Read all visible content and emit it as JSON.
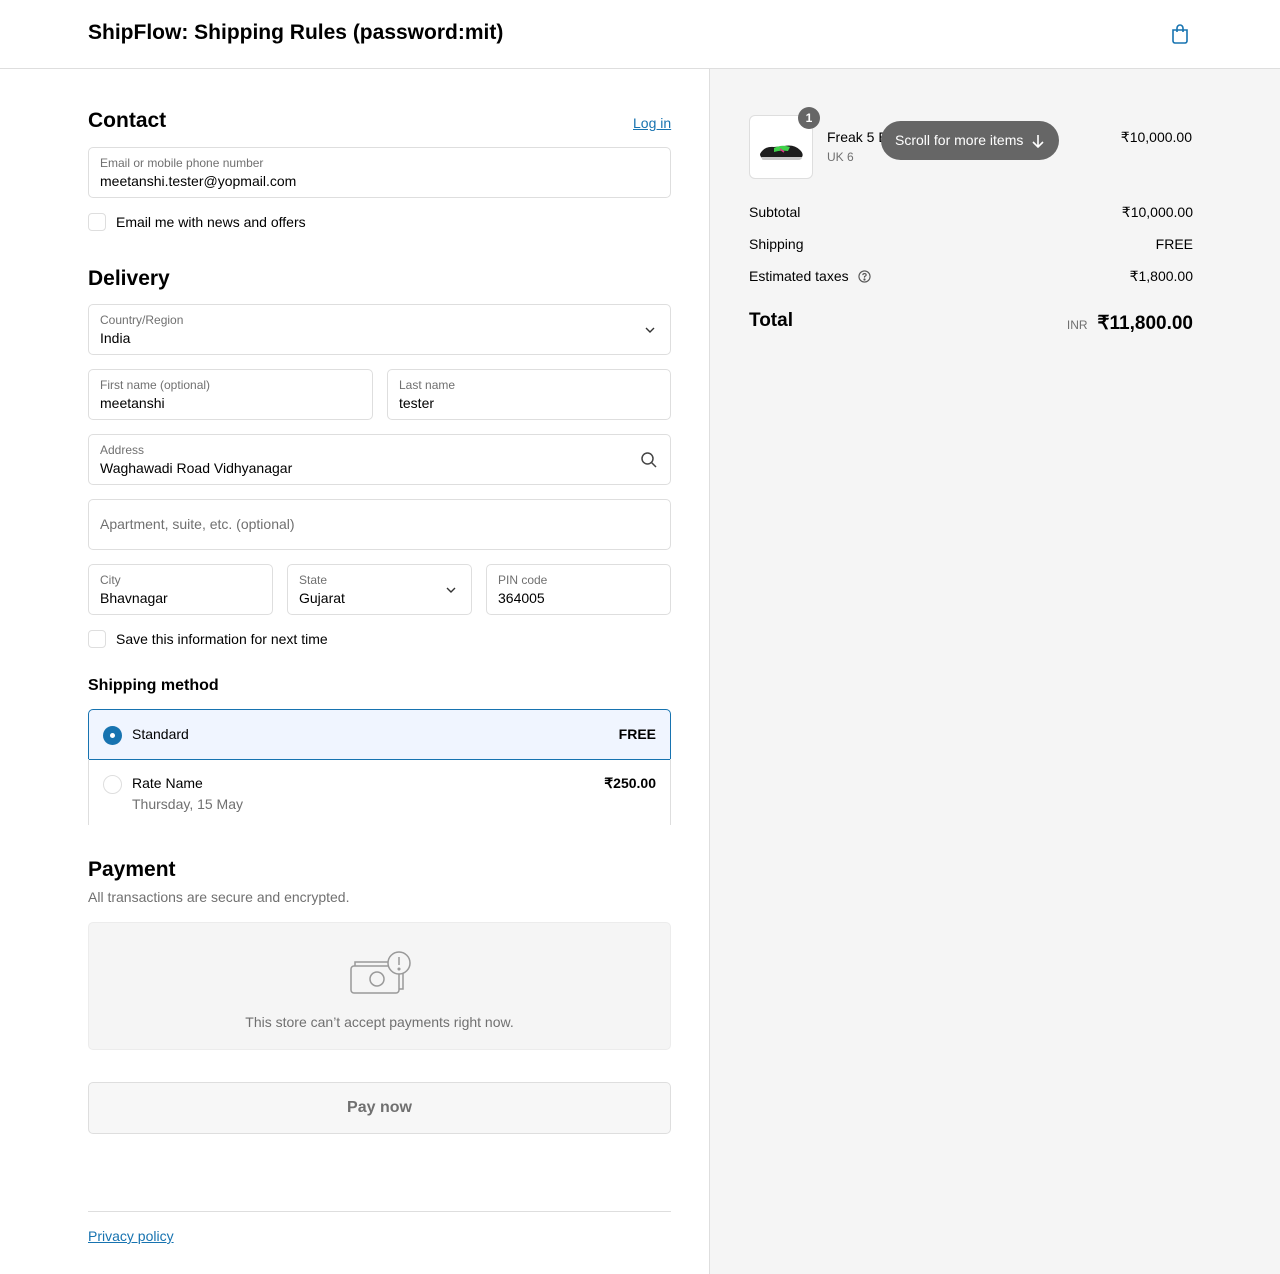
{
  "header": {
    "title": "ShipFlow: Shipping Rules (password:mit)"
  },
  "contact": {
    "heading": "Contact",
    "login_link": "Log in",
    "email_label": "Email or mobile phone number",
    "email_value": "meetanshi.tester@yopmail.com",
    "news_checkbox": "Email me with news and offers"
  },
  "delivery": {
    "heading": "Delivery",
    "country_label": "Country/Region",
    "country_value": "India",
    "first_name_label": "First name (optional)",
    "first_name_value": "meetanshi",
    "last_name_label": "Last name",
    "last_name_value": "tester",
    "address_label": "Address",
    "address_value": "Waghawadi Road Vidhyanagar",
    "apartment_placeholder": "Apartment, suite, etc. (optional)",
    "city_label": "City",
    "city_value": "Bhavnagar",
    "state_label": "State",
    "state_value": "Gujarat",
    "pin_label": "PIN code",
    "pin_value": "364005",
    "save_checkbox": "Save this information for next time"
  },
  "shipping": {
    "heading": "Shipping method",
    "options": [
      {
        "name": "Standard",
        "price": "FREE",
        "selected": true
      },
      {
        "name": "Rate Name",
        "subtitle": "Thursday, 15 May",
        "price": "₹250.00",
        "selected": false
      }
    ]
  },
  "payment": {
    "heading": "Payment",
    "subheading": "All transactions are secure and encrypted.",
    "unavailable_msg": "This store can’t accept payments right now.",
    "pay_button": "Pay now"
  },
  "footer": {
    "privacy_link": "Privacy policy"
  },
  "summary": {
    "item": {
      "name": "Freak 5 E",
      "variant": "UK 6",
      "qty": "1",
      "price": "₹10,000.00"
    },
    "scroll_hint": "Scroll for more items",
    "subtotal_label": "Subtotal",
    "subtotal_value": "₹10,000.00",
    "shipping_label": "Shipping",
    "shipping_value": "FREE",
    "taxes_label": "Estimated taxes",
    "taxes_value": "₹1,800.00",
    "total_label": "Total",
    "currency": "INR",
    "total_value": "₹11,800.00"
  },
  "colors": {
    "accent": "#1773b0",
    "selected_bg": "#f0f5ff",
    "summary_bg": "#f5f5f5"
  }
}
